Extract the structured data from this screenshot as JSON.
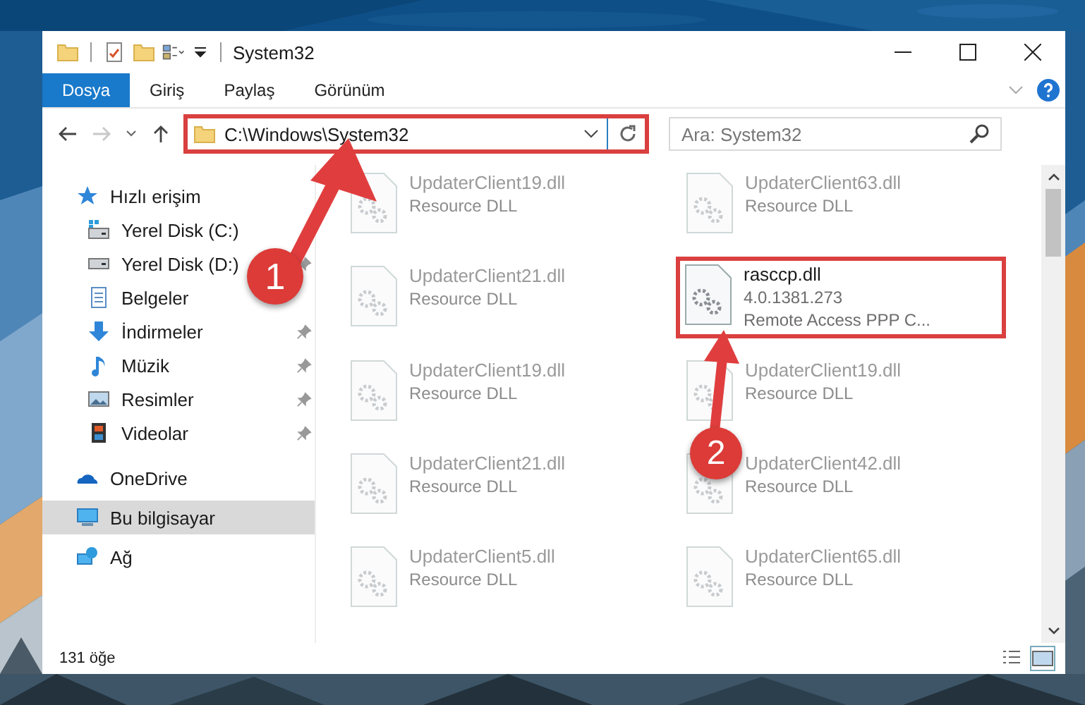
{
  "window": {
    "title": "System32"
  },
  "ribbon_tabs": [
    {
      "label": "Dosya",
      "selected": true
    },
    {
      "label": "Giriş",
      "selected": false
    },
    {
      "label": "Paylaş",
      "selected": false
    },
    {
      "label": "Görünüm",
      "selected": false
    }
  ],
  "address_bar": {
    "path": "C:\\Windows\\System32",
    "highlighted": true
  },
  "search": {
    "placeholder": "Ara: System32"
  },
  "sidebar": {
    "items": [
      {
        "label": "Hızlı erişim",
        "kind": "star",
        "selected": false,
        "children": [
          {
            "label": "Yerel Disk (C:)",
            "kind": "drive-c",
            "selected": false,
            "pinned": false
          },
          {
            "label": "Yerel Disk (D:)",
            "kind": "drive",
            "selected": false,
            "pinned": true
          },
          {
            "label": "Belgeler",
            "kind": "document",
            "selected": false,
            "pinned": false
          },
          {
            "label": "İndirmeler",
            "kind": "download",
            "selected": false,
            "pinned": true
          },
          {
            "label": "Müzik",
            "kind": "music",
            "selected": false,
            "pinned": true
          },
          {
            "label": "Resimler",
            "kind": "pictures",
            "selected": false,
            "pinned": true
          },
          {
            "label": "Videolar",
            "kind": "video",
            "selected": false,
            "pinned": true
          }
        ]
      },
      {
        "label": "OneDrive",
        "kind": "cloud",
        "selected": false
      },
      {
        "label": "Bu bilgisayar",
        "kind": "computer",
        "selected": true
      },
      {
        "label": "Ağ",
        "kind": "network",
        "selected": false
      }
    ]
  },
  "files": [
    {
      "name": "UpdaterClient19.dll",
      "details": [
        "Resource DLL"
      ],
      "faded": true,
      "highlighted": false
    },
    {
      "name": "UpdaterClient63.dll",
      "details": [
        "Resource DLL"
      ],
      "faded": true,
      "highlighted": false
    },
    {
      "name": "UpdaterClient21.dll",
      "details": [
        "Resource DLL"
      ],
      "faded": true,
      "highlighted": false
    },
    {
      "name": "rasccp.dll",
      "details": [
        "4.0.1381.273",
        "Remote Access PPP C..."
      ],
      "faded": false,
      "highlighted": true
    },
    {
      "name": "UpdaterClient19.dll",
      "details": [
        "Resource DLL"
      ],
      "faded": true,
      "highlighted": false
    },
    {
      "name": "UpdaterClient19.dll",
      "details": [
        "Resource DLL"
      ],
      "faded": true,
      "highlighted": false
    },
    {
      "name": "UpdaterClient21.dll",
      "details": [
        "Resource DLL"
      ],
      "faded": true,
      "highlighted": false
    },
    {
      "name": "UpdaterClient42.dll",
      "details": [
        "Resource DLL"
      ],
      "faded": true,
      "highlighted": false
    },
    {
      "name": "UpdaterClient5.dll",
      "details": [
        "Resource DLL"
      ],
      "faded": true,
      "highlighted": false
    },
    {
      "name": "UpdaterClient65.dll",
      "details": [
        "Resource DLL"
      ],
      "faded": true,
      "highlighted": false
    }
  ],
  "status_bar": {
    "item_count": "131 öğe"
  },
  "annotations": [
    {
      "number": "1"
    },
    {
      "number": "2"
    }
  ]
}
